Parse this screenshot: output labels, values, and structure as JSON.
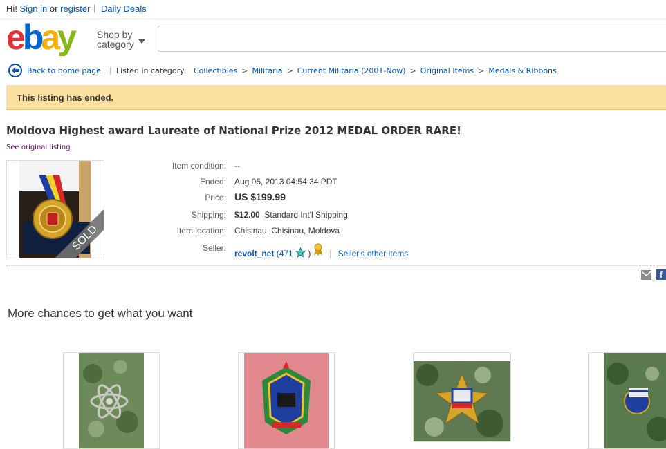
{
  "topbar": {
    "greeting": "Hi!",
    "sign_in": "Sign in",
    "or": "or",
    "register": "register",
    "separator": "|",
    "daily_deals": "Daily Deals"
  },
  "header": {
    "shop_by_line1": "Shop by",
    "shop_by_line2": "category",
    "search_value": ""
  },
  "breadcrumb": {
    "back": "Back to home page",
    "bar": "|",
    "listed_in": "Listed in category:",
    "path": [
      "Collectibles",
      "Militaria",
      "Current Militaria (2001-Now)",
      "Original Items",
      "Medals & Ribbons"
    ],
    "sep": ">"
  },
  "banner": {
    "text": "This listing has ended."
  },
  "listing": {
    "title": "Moldova Highest award Laureate of National Prize 2012 MEDAL ORDER RARE!",
    "see_original": "See original listing",
    "sold_ribbon": "SOLD"
  },
  "details": {
    "condition_label": "Item condition:",
    "condition_value": "--",
    "ended_label": "Ended:",
    "ended_value": "Aug 05, 2013  04:54:34 PDT",
    "price_label": "Price:",
    "price_value": "US $199.99",
    "shipping_label": "Shipping:",
    "shipping_cost": "$12.00",
    "shipping_method": "Standard Int'l Shipping",
    "location_label": "Item location:",
    "location_value": "Chisinau, Chisinau, Moldova",
    "seller_label": "Seller:",
    "seller_name": "revolt_net",
    "seller_score_open": "(471",
    "seller_score_close": ")",
    "seller_sep": "|",
    "seller_other": "Seller's other items"
  },
  "share": {
    "facebook_glyph": "f"
  },
  "more": {
    "heading": "More chances to get what you want"
  },
  "colors": {
    "link": "#0654ba",
    "banner_bg": "#f9e0a0",
    "ebay_red": "#e53238",
    "ebay_blue": "#0064d2",
    "ebay_yellow": "#f5af02",
    "ebay_green": "#86b817"
  },
  "icons": [
    "back-arrow-icon",
    "caret-down-icon",
    "star-icon",
    "ribbon-icon",
    "mail-icon",
    "facebook-icon"
  ]
}
